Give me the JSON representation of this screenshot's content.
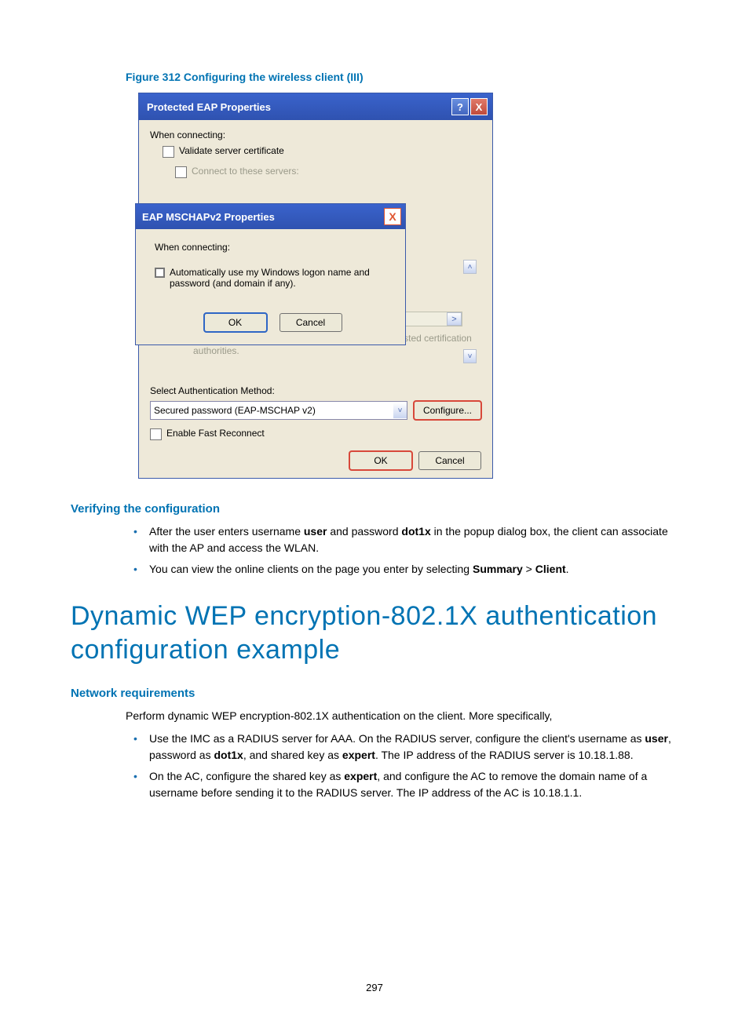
{
  "figure_caption": "Figure 312 Configuring the wireless client (III)",
  "outer_dialog": {
    "title": "Protected EAP Properties",
    "help_glyph": "?",
    "close_glyph": "X",
    "when_connecting": "When connecting:",
    "validate_cert": "Validate server certificate",
    "connect_servers": "Connect to these servers:",
    "do_not_prompt": "Do not prompt user to authorize new servers or trusted certification authorities.",
    "select_auth": "Select Authentication Method:",
    "auth_method_value": "Secured password (EAP-MSCHAP v2)",
    "configure_btn": "Configure...",
    "fast_reconnect": "Enable Fast Reconnect",
    "ok": "OK",
    "cancel": "Cancel"
  },
  "inner_dialog": {
    "title": "EAP MSCHAPv2 Properties",
    "close_glyph": "X",
    "when_connecting": "When connecting:",
    "auto_use": "Automatically use my Windows logon name and password (and domain if any).",
    "ok": "OK",
    "cancel": "Cancel"
  },
  "scroll": {
    "left": "<",
    "right": ">",
    "up": "˄",
    "down": "˅",
    "dd": "˅"
  },
  "verify_h": "Verifying the configuration",
  "verify_items": [
    {
      "pre": "After the user enters username ",
      "b1": "user",
      "mid": " and password ",
      "b2": "dot1x",
      "post": " in the popup dialog box, the client can associate with the AP and access the WLAN."
    },
    {
      "pre": "You can view the online clients on the page you enter by selecting ",
      "b1": "Summary",
      "mid": " > ",
      "b2": "Client",
      "post": "."
    }
  ],
  "big_h": "Dynamic WEP encryption-802.1X authentication configuration example",
  "net_h": "Network requirements",
  "net_intro": "Perform dynamic WEP encryption-802.1X authentication on the client. More specifically,",
  "net_items": [
    {
      "pre": "Use the IMC as a RADIUS server for AAA. On the RADIUS server, configure the client's username as ",
      "b1": "user",
      "mid1": ", password as ",
      "b2": "dot1x",
      "mid2": ", and shared key as ",
      "b3": "expert",
      "post": ". The IP address of the RADIUS server is 10.18.1.88."
    },
    {
      "pre": "On the AC, configure the shared key as ",
      "b1": "expert",
      "post": ", and configure the AC to remove the domain name of a username before sending it to the RADIUS server. The IP address of the AC is 10.18.1.1."
    }
  ],
  "page_number": "297"
}
